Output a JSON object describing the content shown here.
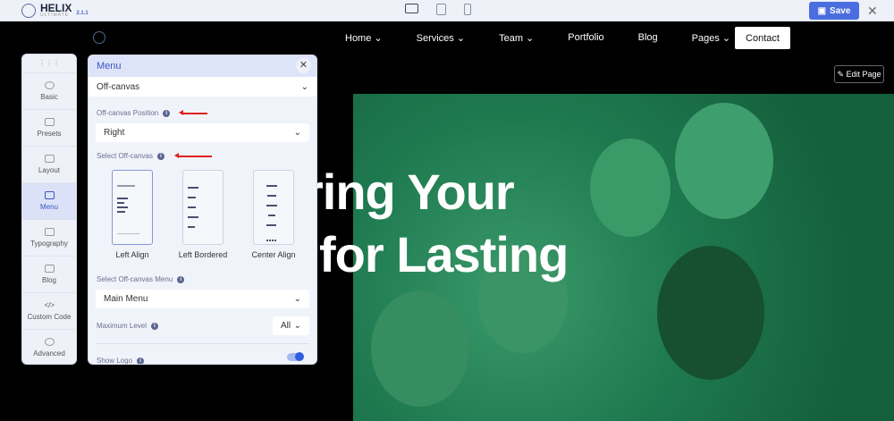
{
  "app": {
    "name": "HELIX",
    "subtitle": "ULTIMATE",
    "version": "2.1.1",
    "save_label": "Save"
  },
  "site": {
    "nav": [
      "Home",
      "Services",
      "Team",
      "Portfolio",
      "Blog",
      "Pages"
    ],
    "nav_dropdown": [
      true,
      true,
      true,
      false,
      false,
      true
    ],
    "contact": "Contact",
    "edit_page": "Edit Page",
    "headline": [
      "ring Your",
      "for Lasting"
    ]
  },
  "sidebar": {
    "items": [
      {
        "label": "Basic",
        "icon": "gear-icon"
      },
      {
        "label": "Presets",
        "icon": "sliders-icon"
      },
      {
        "label": "Layout",
        "icon": "layout-icon"
      },
      {
        "label": "Menu",
        "icon": "menu-icon",
        "active": true
      },
      {
        "label": "Typography",
        "icon": "typography-icon"
      },
      {
        "label": "Blog",
        "icon": "blog-icon"
      },
      {
        "label": "Custom Code",
        "icon": "code-icon"
      },
      {
        "label": "Advanced",
        "icon": "advanced-icon"
      }
    ]
  },
  "panel": {
    "title": "Menu",
    "section": "Off-canvas",
    "position_label": "Off-canvas Position",
    "position_value": "Right",
    "select_label": "Select Off-canvas",
    "options": [
      "Left Align",
      "Left Bordered",
      "Center Align"
    ],
    "selected_option": "Left Align",
    "menu_label": "Select Off-canvas Menu",
    "menu_value": "Main Menu",
    "max_level_label": "Maximum Level",
    "max_level_value": "All",
    "show_logo_label": "Show Logo",
    "show_logo": true
  }
}
